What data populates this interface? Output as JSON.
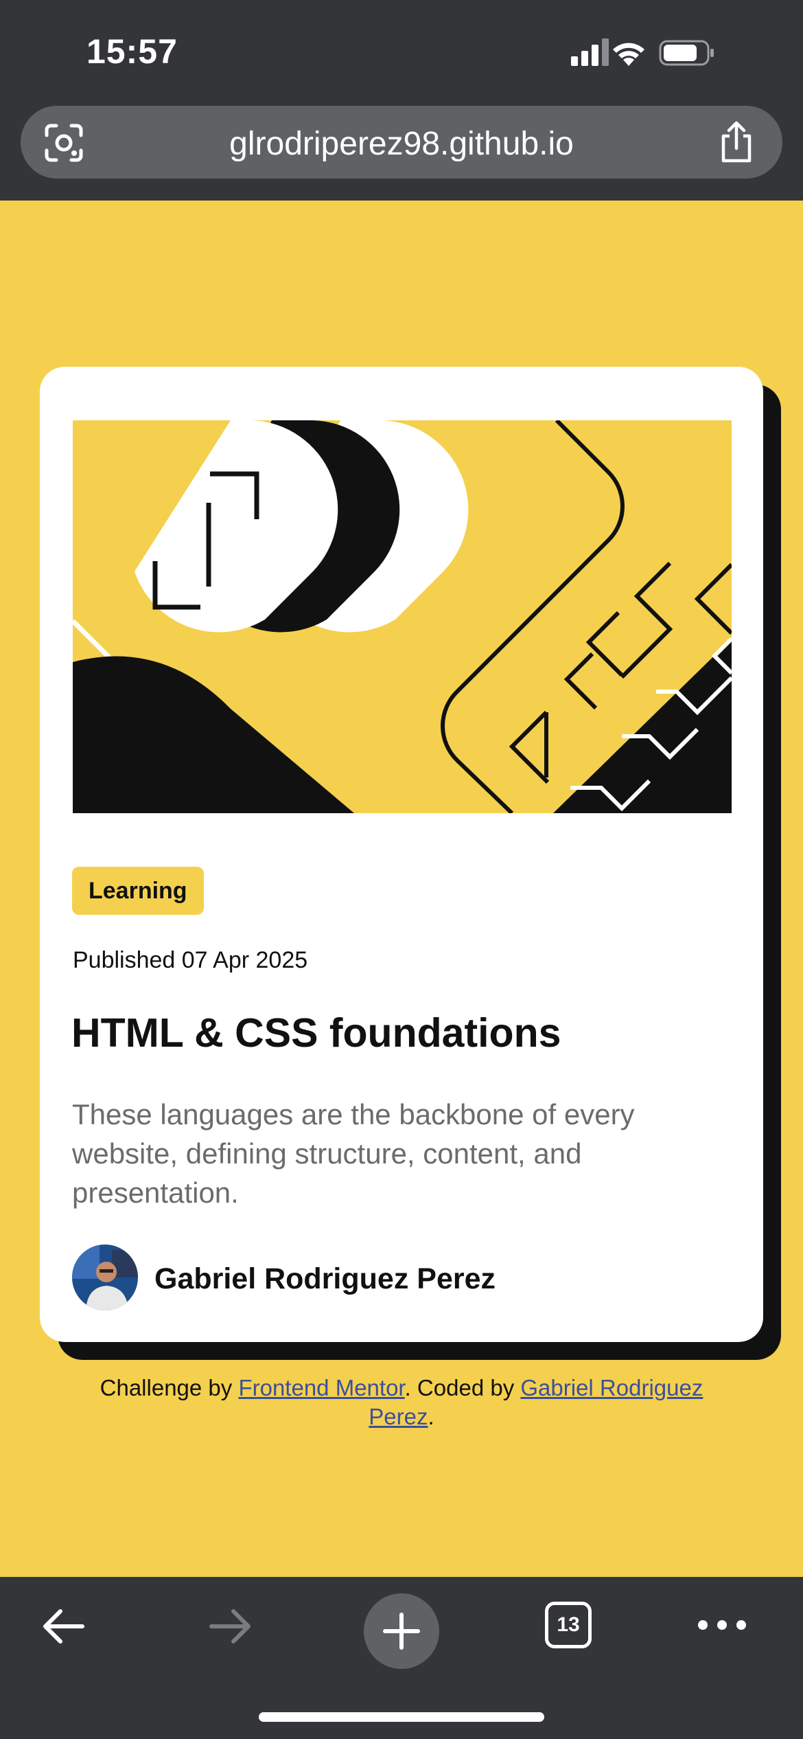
{
  "status_bar": {
    "time": "15:57",
    "icons": [
      "signal-icon",
      "wifi-icon",
      "battery-icon"
    ]
  },
  "browser": {
    "url": "glrodriperez98.github.io",
    "tab_count": "13",
    "toolbar_icons": [
      "back-arrow-icon",
      "forward-arrow-icon",
      "plus-icon",
      "tabs-icon",
      "more-icon"
    ]
  },
  "card": {
    "tag": "Learning",
    "published": "Published 07 Apr 2025",
    "title": "HTML & CSS foundations",
    "description": "These languages are the backbone of every website, defining structure, content, and presentation.",
    "author": "Gabriel Rodriguez Perez"
  },
  "attribution": {
    "prefix": "Challenge by ",
    "link1": "Frontend Mentor",
    "middle": ". Coded by ",
    "link2": "Gabriel Rodriguez Perez",
    "suffix": "."
  },
  "colors": {
    "background": "#f4d04e",
    "chrome": "#333538",
    "card": "#ffffff",
    "ink": "#111111",
    "link": "#3b4f9e"
  }
}
